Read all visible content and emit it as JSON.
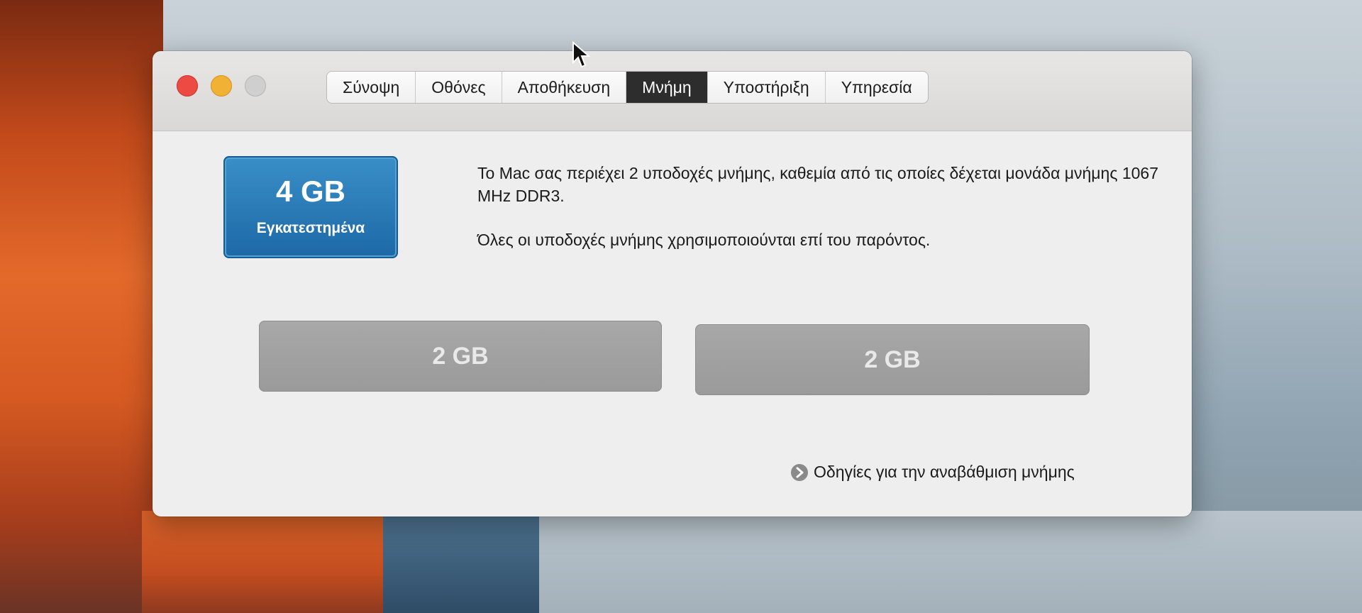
{
  "window": {
    "tabs": [
      {
        "label": "Σύνοψη",
        "active": false
      },
      {
        "label": "Οθόνες",
        "active": false
      },
      {
        "label": "Αποθήκευση",
        "active": false
      },
      {
        "label": "Μνήμη",
        "active": true
      },
      {
        "label": "Υποστήριξη",
        "active": false
      },
      {
        "label": "Υπηρεσία",
        "active": false
      }
    ]
  },
  "memory": {
    "installed_size": "4 GB",
    "installed_label": "Εγκατεστημένα",
    "description_line1": "Το Mac σας περιέχει 2 υποδοχές μνήμης, καθεμία από τις οποίες δέχεται μονάδα μνήμης 1067 MHz DDR3.",
    "description_line2": "Όλες οι υποδοχές μνήμης χρησιμοποιούνται επί του παρόντος.",
    "slots": [
      {
        "size": "2 GB"
      },
      {
        "size": "2 GB"
      }
    ],
    "upgrade_link": "Οδηγίες για την αναβάθμιση μνήμης"
  },
  "colors": {
    "installed_box": "#1c68a6",
    "close": "#ee4a44",
    "minimize": "#f1b135",
    "zoom": "#cfcfcf"
  }
}
